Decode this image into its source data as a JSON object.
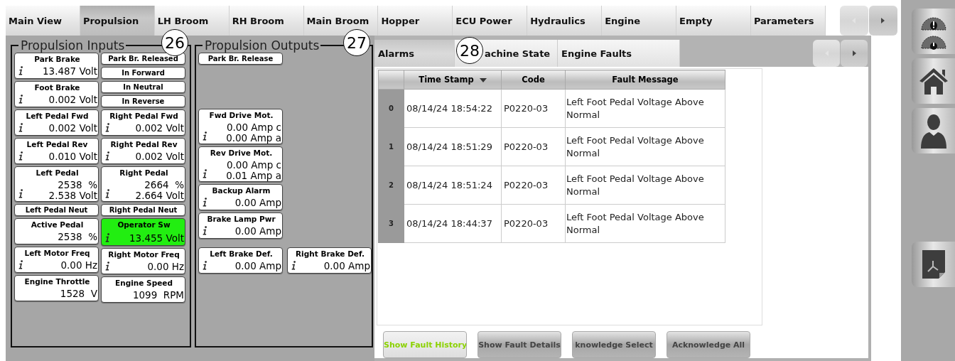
{
  "tabs": [
    {
      "label": "Main View",
      "selected": false
    },
    {
      "label": "Propulsion",
      "selected": true
    },
    {
      "label": "LH Broom",
      "selected": false
    },
    {
      "label": "RH Broom",
      "selected": false
    },
    {
      "label": "Main Broom",
      "selected": false
    },
    {
      "label": "Hopper",
      "selected": false
    },
    {
      "label": "ECU Power",
      "selected": false
    },
    {
      "label": "Hydraulics",
      "selected": false
    },
    {
      "label": "Engine",
      "selected": false
    },
    {
      "label": "Empty",
      "selected": false
    },
    {
      "label": "Parameters",
      "selected": false
    }
  ],
  "tab_scroll": [
    {
      "kind": "prev",
      "disabled": true
    },
    {
      "kind": "next",
      "disabled": false
    }
  ],
  "inputs_panel": {
    "title": "Propulsion Inputs",
    "callout": "26",
    "left": [
      {
        "kind": "reading",
        "label": "Park Brake",
        "values": [
          "13.487 Volt"
        ],
        "info": true,
        "active": false
      },
      {
        "kind": "reading",
        "label": "Foot Brake",
        "values": [
          "0.002 Volt"
        ],
        "info": true,
        "active": false
      },
      {
        "kind": "reading",
        "label": "Left Pedal Fwd",
        "values": [
          "0.002 Volt"
        ],
        "info": true,
        "active": false
      },
      {
        "kind": "reading",
        "label": "Left Pedal Rev",
        "values": [
          "0.010 Volt"
        ],
        "info": true,
        "active": false
      },
      {
        "kind": "dual",
        "label": "Left Pedal",
        "values": [
          "2538  %",
          "2.538 Volt"
        ],
        "info": true,
        "active": false
      },
      {
        "kind": "indicator",
        "label": "Left Pedal Neut",
        "active": false
      },
      {
        "kind": "reading",
        "label": "Active Pedal",
        "values": [
          "2538  %"
        ],
        "info": false,
        "active": false
      },
      {
        "kind": "reading",
        "label": "Left Motor Freq",
        "values": [
          "0.00 Hz"
        ],
        "info": true,
        "active": false
      },
      {
        "kind": "reading",
        "label": "Engine Throttle",
        "values": [
          "1528  V"
        ],
        "info": false,
        "active": false
      }
    ],
    "right": [
      {
        "kind": "indicator",
        "label": "Park Br. Released",
        "active": false
      },
      {
        "kind": "indicator",
        "label": "In Forward",
        "active": false
      },
      {
        "kind": "indicator",
        "label": "In Neutral",
        "active": false
      },
      {
        "kind": "indicator",
        "label": "In Reverse",
        "active": false
      },
      {
        "kind": "reading",
        "label": "Right Pedal Fwd",
        "values": [
          "0.002 Volt"
        ],
        "info": true,
        "active": false
      },
      {
        "kind": "reading",
        "label": "Right Pedal Rev",
        "values": [
          "0.002 Volt"
        ],
        "info": true,
        "active": false
      },
      {
        "kind": "dual",
        "label": "Right Pedal",
        "values": [
          "2664  %",
          "2.664 Volt"
        ],
        "info": true,
        "active": false
      },
      {
        "kind": "indicator",
        "label": "Right Pedal Neut",
        "active": false
      },
      {
        "kind": "reading",
        "label": "Operator Sw",
        "values": [
          "13.455 Volt"
        ],
        "info": true,
        "active": true
      },
      {
        "kind": "reading",
        "label": "Right Motor Freq",
        "values": [
          "0.00 Hz"
        ],
        "info": true,
        "active": false
      },
      {
        "kind": "reading",
        "label": "Engine Speed",
        "values": [
          "1099  RPM"
        ],
        "info": false,
        "active": false
      }
    ]
  },
  "outputs_panel": {
    "title": "Propulsion Outputs",
    "callout": "27",
    "rows": [
      [
        {
          "kind": "indicator",
          "label": "Park Br. Release",
          "active": false
        }
      ],
      [
        {
          "kind": "dual",
          "label": "Fwd Drive Mot.",
          "values": [
            "0.00 Amp c",
            "0.00 Amp a"
          ],
          "info": true,
          "active": false
        }
      ],
      [
        {
          "kind": "dual",
          "label": "Rev Drive Mot.",
          "values": [
            "0.00 Amp c",
            "0.01 Amp a"
          ],
          "info": true,
          "active": false
        }
      ],
      [
        {
          "kind": "reading",
          "label": "Backup Alarm",
          "values": [
            "0.00 Amp"
          ],
          "info": true,
          "active": false
        }
      ],
      [
        {
          "kind": "reading",
          "label": "Brake Lamp Pwr",
          "values": [
            "0.00 Amp"
          ],
          "info": true,
          "active": false
        }
      ],
      [
        {
          "kind": "reading",
          "label": "Left Brake Def.",
          "values": [
            "0.00 Amp"
          ],
          "info": true,
          "active": false
        },
        {
          "kind": "reading",
          "label": "Right Brake Def.",
          "values": [
            "0.00 Amp"
          ],
          "info": true,
          "active": false
        }
      ]
    ]
  },
  "alarms": {
    "callout": "28",
    "tabs": [
      {
        "label": "Alarms",
        "selected": true
      },
      {
        "label": "achine State",
        "selected": false
      },
      {
        "label": "Engine Faults",
        "selected": false
      }
    ],
    "tab_scroll": [
      {
        "kind": "prev",
        "disabled": true
      },
      {
        "kind": "next",
        "disabled": false
      }
    ],
    "table": {
      "columns": [
        {
          "label": "Time Stamp",
          "sorted": true
        },
        {
          "label": "Code",
          "sorted": false
        },
        {
          "label": "Fault Message",
          "sorted": false
        }
      ],
      "rows": [
        {
          "index": "0",
          "cells": [
            "08/14/24 18:54:22",
            "P0220-03",
            "Left Foot Pedal Voltage Above Normal"
          ]
        },
        {
          "index": "1",
          "cells": [
            "08/14/24 18:51:29",
            "P0220-03",
            "Left Foot Pedal Voltage Above Normal"
          ]
        },
        {
          "index": "2",
          "cells": [
            "08/14/24 18:51:24",
            "P0220-03",
            "Left Foot Pedal Voltage Above Normal"
          ]
        },
        {
          "index": "3",
          "cells": [
            "08/14/24 18:44:37",
            "P0220-03",
            "Left Foot Pedal Voltage Above Normal"
          ]
        }
      ]
    },
    "buttons": [
      {
        "label": "Show Fault History",
        "selected": true
      },
      {
        "label": "Show Fault Details",
        "selected": false
      },
      {
        "label": "knowledge Select",
        "selected": false
      },
      {
        "label": "Acknowledge All",
        "selected": false
      }
    ]
  },
  "sidebar": {
    "buttons": [
      {
        "kind": "gauge"
      },
      {
        "kind": "home"
      },
      {
        "kind": "user"
      },
      {
        "kind": "spacer"
      },
      {
        "kind": "pdf"
      }
    ]
  }
}
